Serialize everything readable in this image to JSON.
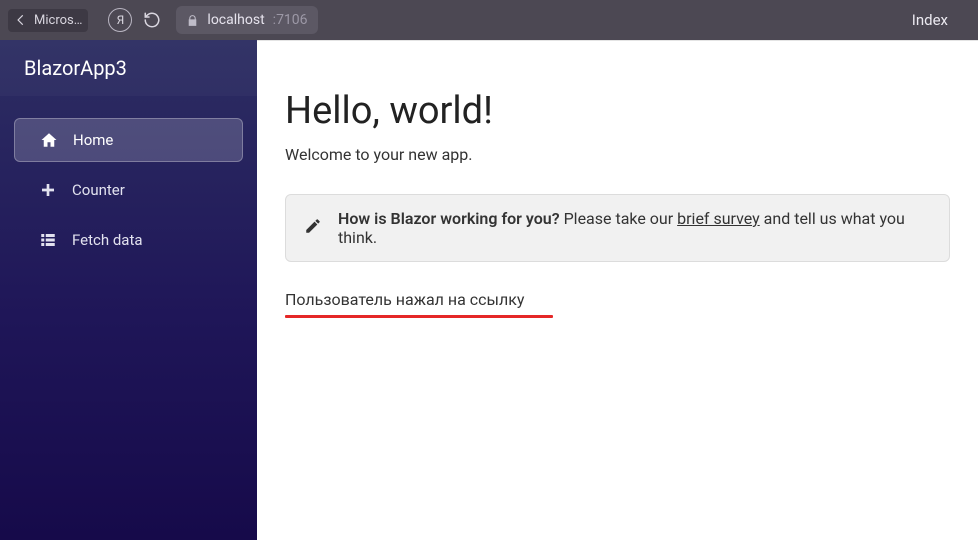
{
  "chrome": {
    "tab_title": "Micros…",
    "address_host": "localhost",
    "address_port": ":7106",
    "page_label": "Index"
  },
  "sidebar": {
    "brand": "BlazorApp3",
    "items": [
      {
        "label": "Home"
      },
      {
        "label": "Counter"
      },
      {
        "label": "Fetch data"
      }
    ]
  },
  "main": {
    "heading": "Hello, world!",
    "welcome": "Welcome to your new app.",
    "survey_bold": "How is Blazor working for you?",
    "survey_text_before": " Please take our ",
    "survey_link": "brief survey",
    "survey_text_after": " and tell us what you think.",
    "message": "Пользователь нажал на ссылку"
  }
}
